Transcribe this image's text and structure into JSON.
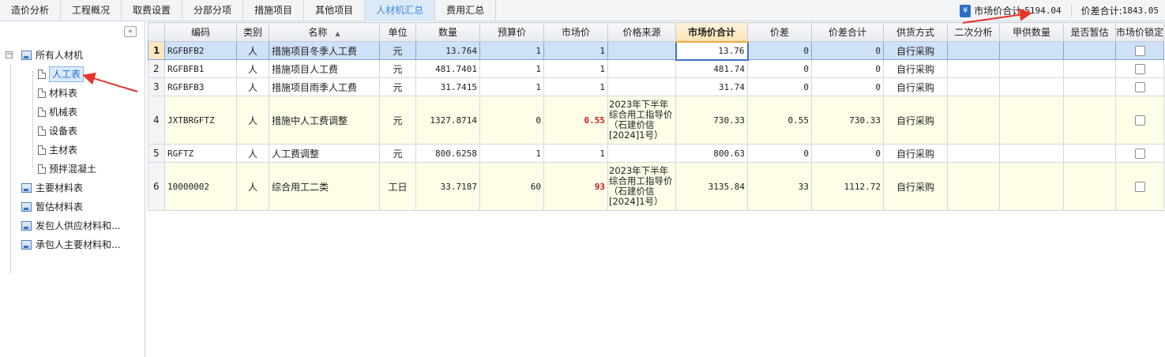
{
  "tabs": [
    {
      "label": "造价分析",
      "active": false
    },
    {
      "label": "工程概况",
      "active": false
    },
    {
      "label": "取费设置",
      "active": false
    },
    {
      "label": "分部分项",
      "active": false
    },
    {
      "label": "措施项目",
      "active": false
    },
    {
      "label": "其他项目",
      "active": false
    },
    {
      "label": "人材机汇总",
      "active": true
    },
    {
      "label": "费用汇总",
      "active": false
    }
  ],
  "totals": {
    "market_label": "市场价合计:",
    "market_value": "5194.04",
    "diff_label": "价差合计:",
    "diff_value": "1843.05"
  },
  "tree": {
    "root": "所有人材机",
    "children": [
      "人工表",
      "材料表",
      "机械表",
      "设备表",
      "主材表",
      "预拌混凝土"
    ],
    "selected": "人工表",
    "others": [
      "主要材料表",
      "暂估材料表",
      "发包人供应材料和...",
      "承包人主要材料和..."
    ]
  },
  "table": {
    "columns": [
      "编码",
      "类别",
      "名称",
      "单位",
      "数量",
      "预算价",
      "市场价",
      "价格来源",
      "市场价合计",
      "价差",
      "价差合计",
      "供货方式",
      "二次分析",
      "甲供数量",
      "是否暂估",
      "市场价锁定"
    ],
    "rows": [
      {
        "no": "1",
        "code": "RGFBFB2",
        "type": "人",
        "name": "措施项目冬季人工费",
        "unit": "元",
        "qty": "13.764",
        "budget": "1",
        "market": "1",
        "market_red": false,
        "source": "",
        "market_total": "13.76",
        "diff": "0",
        "diff_total": "0",
        "supply": "自行采购"
      },
      {
        "no": "2",
        "code": "RGFBFB1",
        "type": "人",
        "name": "措施项目人工费",
        "unit": "元",
        "qty": "481.7401",
        "budget": "1",
        "market": "1",
        "market_red": false,
        "source": "",
        "market_total": "481.74",
        "diff": "0",
        "diff_total": "0",
        "supply": "自行采购"
      },
      {
        "no": "3",
        "code": "RGFBFB3",
        "type": "人",
        "name": "措施项目雨季人工费",
        "unit": "元",
        "qty": "31.7415",
        "budget": "1",
        "market": "1",
        "market_red": false,
        "source": "",
        "market_total": "31.74",
        "diff": "0",
        "diff_total": "0",
        "supply": "自行采购"
      },
      {
        "no": "4",
        "code": "JXTBRGFTZ",
        "type": "人",
        "name": "措施中人工费调整",
        "unit": "元",
        "qty": "1327.8714",
        "budget": "0",
        "market": "0.55",
        "market_red": true,
        "source": "2023年下半年综合用工指导价（石建价信[2024]1号）",
        "market_total": "730.33",
        "diff": "0.55",
        "diff_total": "730.33",
        "supply": "自行采购"
      },
      {
        "no": "5",
        "code": "RGFTZ",
        "type": "人",
        "name": "人工费调整",
        "unit": "元",
        "qty": "800.6258",
        "budget": "1",
        "market": "1",
        "market_red": false,
        "source": "",
        "market_total": "800.63",
        "diff": "0",
        "diff_total": "0",
        "supply": "自行采购"
      },
      {
        "no": "6",
        "code": "10000002",
        "type": "人",
        "name": "综合用工二类",
        "unit": "工日",
        "qty": "33.7187",
        "budget": "60",
        "market": "93",
        "market_red": true,
        "source": "2023年下半年综合用工指导价（石建价信[2024]1号）",
        "market_total": "3135.84",
        "diff": "33",
        "diff_total": "1112.72",
        "supply": "自行采购"
      }
    ]
  },
  "icons": {
    "collapse": "collapse-left-icon",
    "yen": "yen-icon",
    "expand": "minus-expander-icon"
  },
  "colors": {
    "accent": "#3d8be0",
    "highlight_header": "#fde3b5",
    "yellow_row": "#fdfde8",
    "red_value": "#d11a1a",
    "arrow": "#e8332a"
  }
}
